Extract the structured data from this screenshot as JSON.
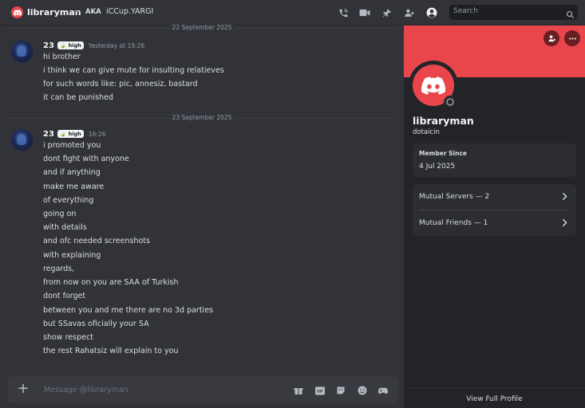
{
  "header": {
    "username": "libraryman",
    "aka_label": "AKA",
    "aka_value": "iCCup.YARGI",
    "icons": [
      "phone-call-icon",
      "video-call-icon",
      "pin-icon",
      "add-friends-icon",
      "user-profile-icon"
    ],
    "search_placeholder": "Search"
  },
  "messages": [
    {
      "date": "22 September 2025",
      "author": "23",
      "tag": "high",
      "timestamp": "Yesterday at 19:26",
      "lines": [
        "hi brother",
        "i think we can give mute for insulting relatieves",
        "for such words like: pic, annesiz, bastard",
        "it can be punished"
      ]
    },
    {
      "date": "23 September 2025",
      "author": "23",
      "tag": "high",
      "timestamp": "16:26",
      "lines": [
        "i promoted you",
        "dont fight with anyone",
        "and if anything",
        "make me aware",
        "of everything",
        "going on",
        "with details",
        "and ofc needed screenshots",
        "with explaining",
        "regards,",
        "from now on you are SAA of Turkish",
        "dont forget",
        "between you and me there are no 3d parties",
        "but SSavas oficially your SA",
        "show respect",
        "the rest Rahatsiz will explain to you"
      ]
    }
  ],
  "composer": {
    "placeholder": "Message @libraryman",
    "icons": [
      "gift-icon",
      "gif-icon",
      "sticker-icon",
      "emoji-icon",
      "apps-icon"
    ]
  },
  "profile": {
    "banner_color": "#e9464b",
    "display_name": "libraryman",
    "username": "dotaicin",
    "member_since_label": "Member Since",
    "member_since_value": "4 Jul 2025",
    "mutual_servers": "Mutual Servers — 2",
    "mutual_friends": "Mutual Friends — 1",
    "view_full_profile": "View Full Profile",
    "status": "offline"
  }
}
